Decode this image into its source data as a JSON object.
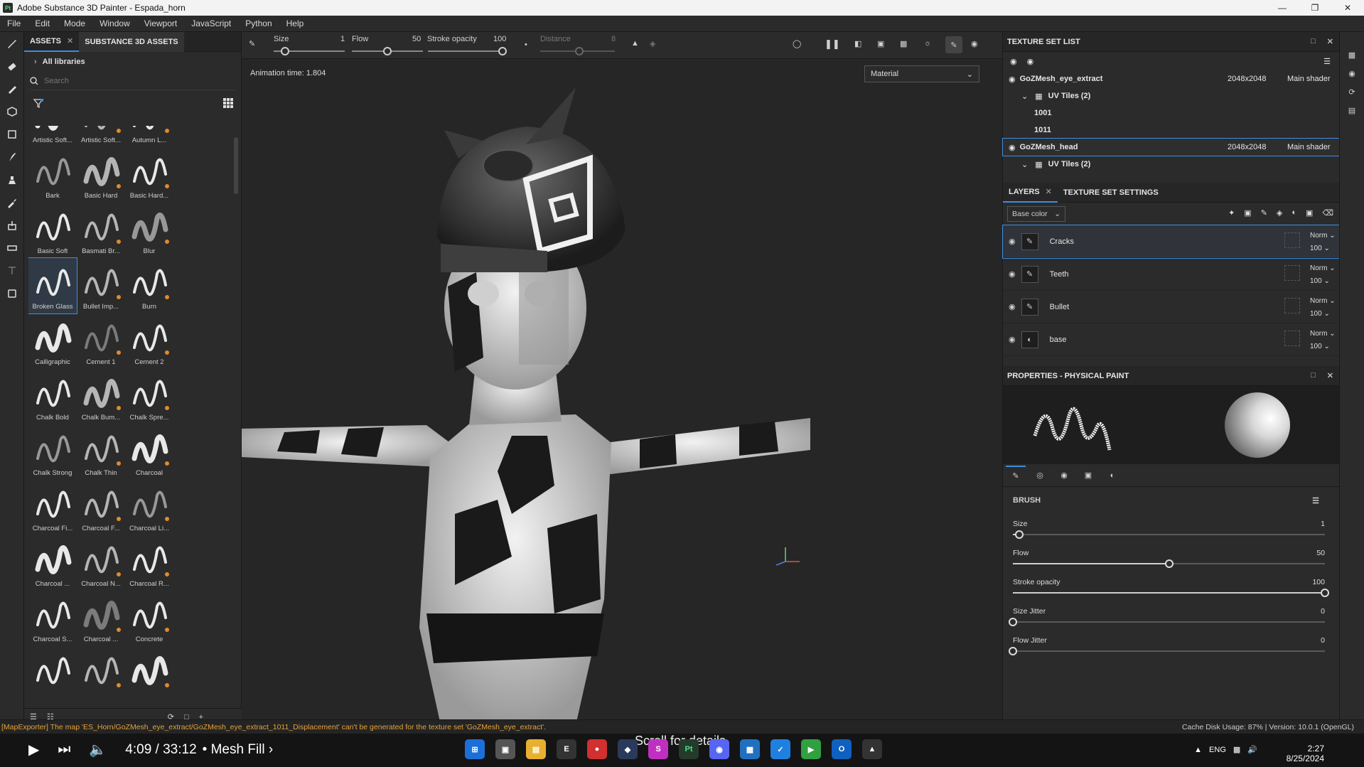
{
  "window": {
    "app_icon": "Pt",
    "title": "Adobe Substance 3D Painter - Espada_horn"
  },
  "menu": [
    "File",
    "Edit",
    "Mode",
    "Window",
    "Viewport",
    "JavaScript",
    "Python",
    "Help"
  ],
  "assets": {
    "tabs": [
      "ASSETS",
      "SUBSTANCE 3D ASSETS"
    ],
    "library": "All libraries",
    "search_placeholder": "Search",
    "brushes": [
      "Artistic Soft...",
      "Artistic Soft...",
      "Autumn L...",
      "Bark",
      "Basic Hard",
      "Basic Hard...",
      "Basic Soft",
      "Basmati Br...",
      "Blur",
      "Broken Glass",
      "Bullet Imp...",
      "Burn",
      "Calligraphic",
      "Cement 1",
      "Cement 2",
      "Chalk Bold",
      "Chalk Bum...",
      "Chalk Spre...",
      "Chalk Strong",
      "Chalk Thin",
      "Charcoal",
      "Charcoal Fi...",
      "Charcoal F...",
      "Charcoal Li...",
      "Charcoal ...",
      "Charcoal N...",
      "Charcoal R...",
      "Charcoal S...",
      "Charcoal ...",
      "Concrete",
      "",
      "",
      ""
    ],
    "selected_brush": "Broken Glass"
  },
  "toolbar": {
    "size_label": "Size",
    "size_value": "1",
    "flow_label": "Flow",
    "flow_value": "50",
    "opacity_label": "Stroke opacity",
    "opacity_value": "100",
    "distance_label": "Distance",
    "distance_value": "8"
  },
  "viewport": {
    "animation_time": "Animation time: 1.804",
    "material_select": "Material"
  },
  "texture_set_list": {
    "title": "TEXTURE SET LIST",
    "sets": [
      {
        "name": "GoZMesh_eye_extract",
        "res": "2048x2048",
        "shader": "Main shader",
        "uv": "UV Tiles (2)",
        "tiles": [
          "1001",
          "1011"
        ]
      },
      {
        "name": "GoZMesh_head",
        "res": "2048x2048",
        "shader": "Main shader",
        "uv": "UV Tiles (2)"
      }
    ]
  },
  "layers": {
    "tabs": [
      "LAYERS",
      "TEXTURE SET SETTINGS"
    ],
    "channel": "Base color",
    "items": [
      {
        "name": "Cracks",
        "blend": "Norm",
        "opacity": "100"
      },
      {
        "name": "Teeth",
        "blend": "Norm",
        "opacity": "100"
      },
      {
        "name": "Bullet",
        "blend": "Norm",
        "opacity": "100"
      },
      {
        "name": "base",
        "blend": "Norm",
        "opacity": "100"
      }
    ]
  },
  "properties": {
    "title": "PROPERTIES - PHYSICAL PAINT",
    "section": "BRUSH",
    "sliders": [
      {
        "label": "Size",
        "value": "1",
        "fraction": 0.02
      },
      {
        "label": "Flow",
        "value": "50",
        "fraction": 0.5
      },
      {
        "label": "Stroke opacity",
        "value": "100",
        "fraction": 1.0
      },
      {
        "label": "Size Jitter",
        "value": "0",
        "fraction": 0
      },
      {
        "label": "Flow Jitter",
        "value": "0",
        "fraction": 0
      }
    ]
  },
  "status": {
    "error": "[MapExporter] The map 'ES_Horn/GoZMesh_eye_extract/GoZMesh_eye_extract_1011_Displacement' can't be generated for the texture set 'GoZMesh_eye_extract'.",
    "cache": "Cache Disk Usage:   87% | Version: 10.0.1 (OpenGL)"
  },
  "player": {
    "time": "4:09 / 33:12",
    "chapter": "• Mesh Fill ›",
    "scroll_hint": "Scroll for details"
  },
  "system": {
    "lang": "ENG",
    "clock_time": "2:27",
    "clock_date": "8/25/2024"
  }
}
